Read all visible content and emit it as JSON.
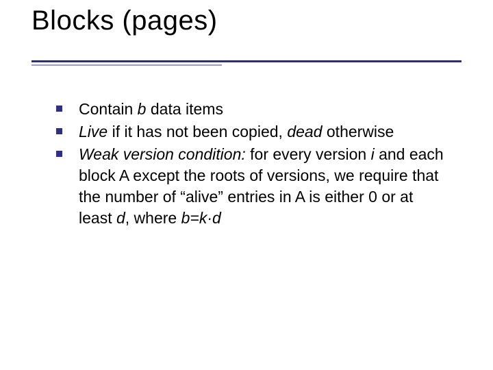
{
  "slide": {
    "title": "Blocks (pages)",
    "bullets": {
      "b1": {
        "t1": "Contain ",
        "i1": "b",
        "t2": " data items"
      },
      "b2": {
        "i1": "Live",
        "t1": " if it has not been copied, ",
        "i2": "dead",
        "t2": " otherwise"
      },
      "b3": {
        "i1": "Weak version condition: ",
        "t1": " for every version ",
        "i2": "i",
        "t2": " and each block A except the roots of versions, we require that the number of “alive” entries in A is either 0 or at least ",
        "i3": "d",
        "t3": ", where ",
        "i4": "b=k·d"
      }
    }
  }
}
